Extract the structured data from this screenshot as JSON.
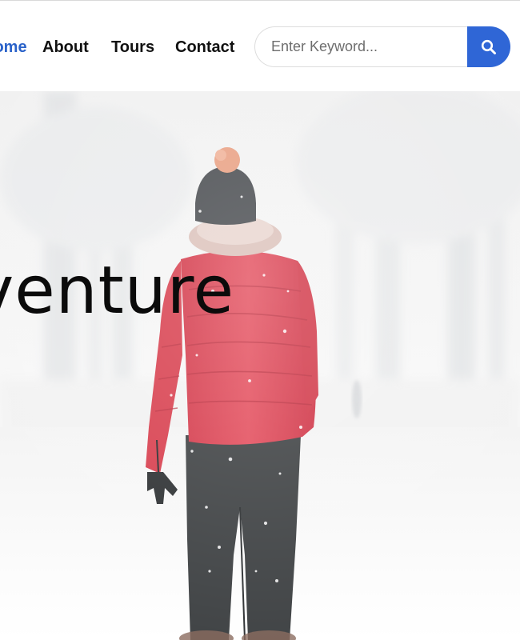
{
  "header": {
    "nav": [
      {
        "label": "Home",
        "active": true
      },
      {
        "label": "About",
        "active": false
      },
      {
        "label": "Tours",
        "active": false
      },
      {
        "label": "Contact",
        "active": false
      }
    ],
    "search": {
      "placeholder": "Enter Keyword...",
      "button_icon": "search-icon"
    }
  },
  "hero": {
    "title": "Adventure",
    "image": "woman-in-red-jacket-snowfall"
  },
  "colors": {
    "accent": "#2f66d6",
    "active_nav": "#2a62c9",
    "nav_text": "#111111",
    "jacket": "#e04857"
  }
}
